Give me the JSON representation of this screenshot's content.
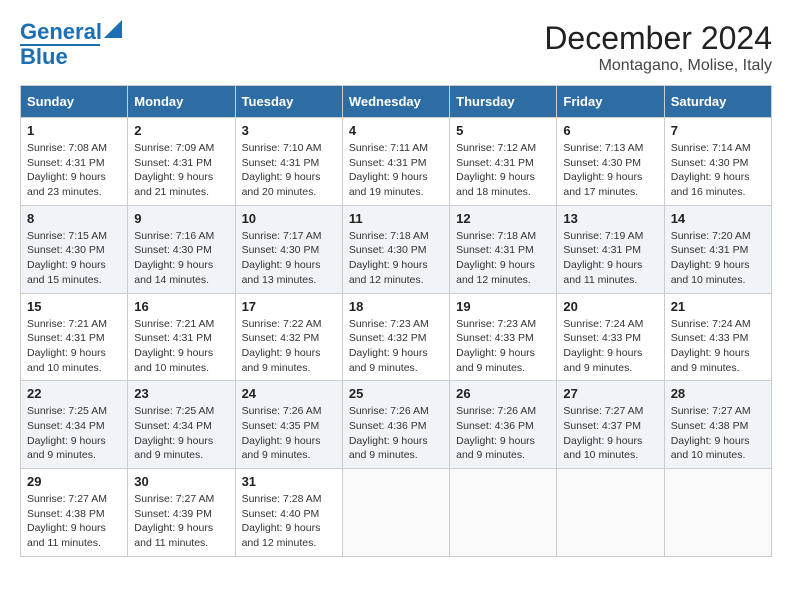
{
  "logo": {
    "line1": "General",
    "line2": "Blue"
  },
  "title": "December 2024",
  "subtitle": "Montagano, Molise, Italy",
  "days_of_week": [
    "Sunday",
    "Monday",
    "Tuesday",
    "Wednesday",
    "Thursday",
    "Friday",
    "Saturday"
  ],
  "weeks": [
    [
      {
        "day": "1",
        "sunrise": "7:08 AM",
        "sunset": "4:31 PM",
        "daylight": "9 hours and 23 minutes."
      },
      {
        "day": "2",
        "sunrise": "7:09 AM",
        "sunset": "4:31 PM",
        "daylight": "9 hours and 21 minutes."
      },
      {
        "day": "3",
        "sunrise": "7:10 AM",
        "sunset": "4:31 PM",
        "daylight": "9 hours and 20 minutes."
      },
      {
        "day": "4",
        "sunrise": "7:11 AM",
        "sunset": "4:31 PM",
        "daylight": "9 hours and 19 minutes."
      },
      {
        "day": "5",
        "sunrise": "7:12 AM",
        "sunset": "4:31 PM",
        "daylight": "9 hours and 18 minutes."
      },
      {
        "day": "6",
        "sunrise": "7:13 AM",
        "sunset": "4:30 PM",
        "daylight": "9 hours and 17 minutes."
      },
      {
        "day": "7",
        "sunrise": "7:14 AM",
        "sunset": "4:30 PM",
        "daylight": "9 hours and 16 minutes."
      }
    ],
    [
      {
        "day": "8",
        "sunrise": "7:15 AM",
        "sunset": "4:30 PM",
        "daylight": "9 hours and 15 minutes."
      },
      {
        "day": "9",
        "sunrise": "7:16 AM",
        "sunset": "4:30 PM",
        "daylight": "9 hours and 14 minutes."
      },
      {
        "day": "10",
        "sunrise": "7:17 AM",
        "sunset": "4:30 PM",
        "daylight": "9 hours and 13 minutes."
      },
      {
        "day": "11",
        "sunrise": "7:18 AM",
        "sunset": "4:30 PM",
        "daylight": "9 hours and 12 minutes."
      },
      {
        "day": "12",
        "sunrise": "7:18 AM",
        "sunset": "4:31 PM",
        "daylight": "9 hours and 12 minutes."
      },
      {
        "day": "13",
        "sunrise": "7:19 AM",
        "sunset": "4:31 PM",
        "daylight": "9 hours and 11 minutes."
      },
      {
        "day": "14",
        "sunrise": "7:20 AM",
        "sunset": "4:31 PM",
        "daylight": "9 hours and 10 minutes."
      }
    ],
    [
      {
        "day": "15",
        "sunrise": "7:21 AM",
        "sunset": "4:31 PM",
        "daylight": "9 hours and 10 minutes."
      },
      {
        "day": "16",
        "sunrise": "7:21 AM",
        "sunset": "4:31 PM",
        "daylight": "9 hours and 10 minutes."
      },
      {
        "day": "17",
        "sunrise": "7:22 AM",
        "sunset": "4:32 PM",
        "daylight": "9 hours and 9 minutes."
      },
      {
        "day": "18",
        "sunrise": "7:23 AM",
        "sunset": "4:32 PM",
        "daylight": "9 hours and 9 minutes."
      },
      {
        "day": "19",
        "sunrise": "7:23 AM",
        "sunset": "4:33 PM",
        "daylight": "9 hours and 9 minutes."
      },
      {
        "day": "20",
        "sunrise": "7:24 AM",
        "sunset": "4:33 PM",
        "daylight": "9 hours and 9 minutes."
      },
      {
        "day": "21",
        "sunrise": "7:24 AM",
        "sunset": "4:33 PM",
        "daylight": "9 hours and 9 minutes."
      }
    ],
    [
      {
        "day": "22",
        "sunrise": "7:25 AM",
        "sunset": "4:34 PM",
        "daylight": "9 hours and 9 minutes."
      },
      {
        "day": "23",
        "sunrise": "7:25 AM",
        "sunset": "4:34 PM",
        "daylight": "9 hours and 9 minutes."
      },
      {
        "day": "24",
        "sunrise": "7:26 AM",
        "sunset": "4:35 PM",
        "daylight": "9 hours and 9 minutes."
      },
      {
        "day": "25",
        "sunrise": "7:26 AM",
        "sunset": "4:36 PM",
        "daylight": "9 hours and 9 minutes."
      },
      {
        "day": "26",
        "sunrise": "7:26 AM",
        "sunset": "4:36 PM",
        "daylight": "9 hours and 9 minutes."
      },
      {
        "day": "27",
        "sunrise": "7:27 AM",
        "sunset": "4:37 PM",
        "daylight": "9 hours and 10 minutes."
      },
      {
        "day": "28",
        "sunrise": "7:27 AM",
        "sunset": "4:38 PM",
        "daylight": "9 hours and 10 minutes."
      }
    ],
    [
      {
        "day": "29",
        "sunrise": "7:27 AM",
        "sunset": "4:38 PM",
        "daylight": "9 hours and 11 minutes."
      },
      {
        "day": "30",
        "sunrise": "7:27 AM",
        "sunset": "4:39 PM",
        "daylight": "9 hours and 11 minutes."
      },
      {
        "day": "31",
        "sunrise": "7:28 AM",
        "sunset": "4:40 PM",
        "daylight": "9 hours and 12 minutes."
      },
      null,
      null,
      null,
      null
    ]
  ]
}
